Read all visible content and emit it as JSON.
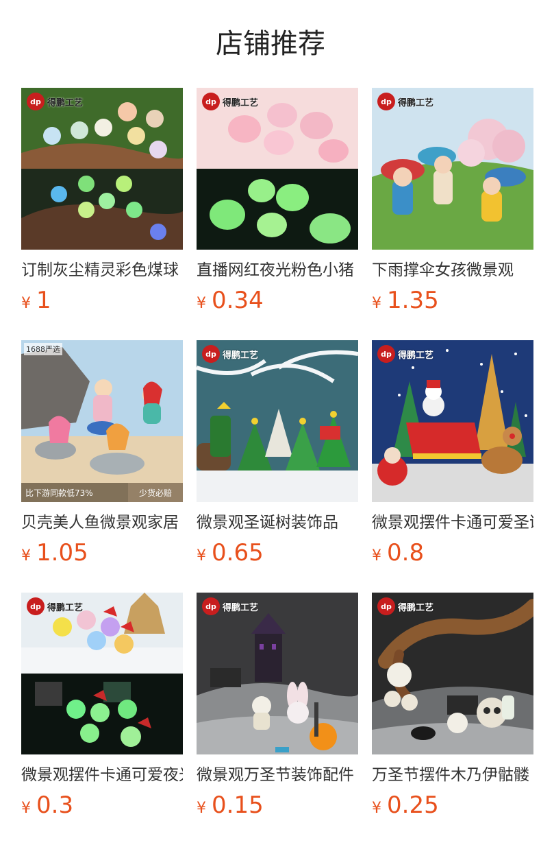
{
  "page": {
    "title": "店铺推荐"
  },
  "brand": {
    "logo": "dp",
    "name": "得鹏工艺"
  },
  "colors": {
    "price": "#e8501c",
    "text": "#333333",
    "brand_red": "#c81e1e"
  },
  "products": [
    {
      "name": "订制灰尘精灵彩色煤球",
      "currency": "¥",
      "price": "1",
      "image": "glow-dust-sprites"
    },
    {
      "name": "直播网红夜光粉色小猪",
      "currency": "¥",
      "price": "0.34",
      "image": "glow-pink-pigs"
    },
    {
      "name": "下雨撑伞女孩微景观",
      "currency": "¥",
      "price": "1.35",
      "image": "umbrella-kids"
    },
    {
      "name": "贝壳美人鱼微景观家居",
      "currency": "¥",
      "price": "1.05",
      "image": "mermaids",
      "badge": "1688严选",
      "promo_left": "比下游同款低73%",
      "promo_right": "少货必赔"
    },
    {
      "name": "微景观圣诞树装饰品",
      "currency": "¥",
      "price": "0.65",
      "image": "christmas-trees"
    },
    {
      "name": "微景观摆件卡通可爱圣诞",
      "currency": "¥",
      "price": "0.8",
      "image": "santa-sleigh"
    },
    {
      "name": "微景观摆件卡通可爱夜光",
      "currency": "¥",
      "price": "0.3",
      "image": "glow-ducks"
    },
    {
      "name": "微景观万圣节装饰配件",
      "currency": "¥",
      "price": "0.15",
      "image": "halloween-bunny"
    },
    {
      "name": "万圣节摆件木乃伊骷髅",
      "currency": "¥",
      "price": "0.25",
      "image": "halloween-skulls"
    }
  ]
}
